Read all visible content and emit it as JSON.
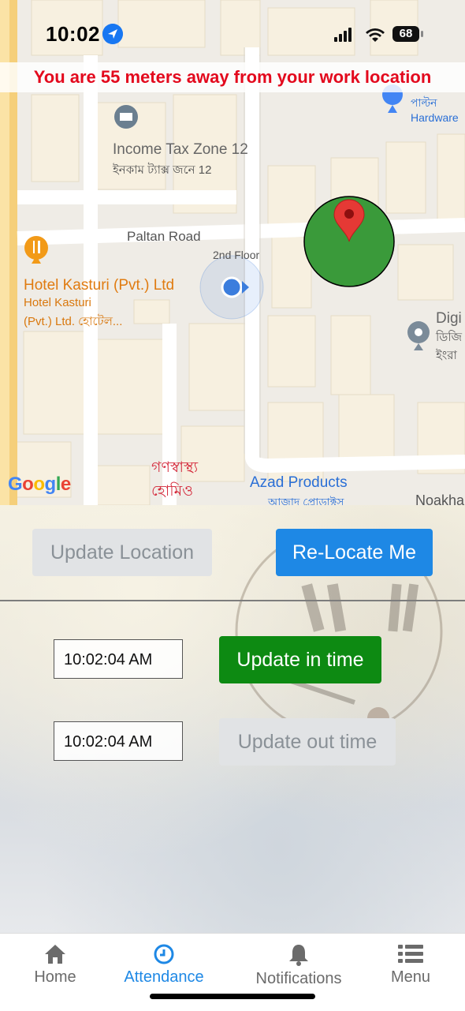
{
  "status_bar": {
    "time": "10:02",
    "battery": "68"
  },
  "banner": {
    "text": "You are 55 meters away from your work location"
  },
  "map": {
    "labels": {
      "income_tax_en": "Income Tax Zone 12",
      "income_tax_bn": "ইনকাম ট্যাক্স জনে 12",
      "paltan_road": "Paltan Road",
      "hotel_en": "Hotel Kasturi (Pvt.) Ltd",
      "hotel_sub1": "Hotel Kasturi",
      "hotel_sub2": "(Pvt.) Ltd. হোটেল...",
      "second_floor": "2nd Floor",
      "paltan_hw_bn": "পাল্টন",
      "paltan_hw_en": "Hardware",
      "digi_en": "Digi",
      "digi_bn1": "ডিজি",
      "digi_bn2": "ইংরা",
      "gono_bn1": "গণস্বাস্থ্য",
      "gono_bn2": "হোমিও",
      "azad_en": "Azad Products",
      "azad_bn": "আজাদ প্রোডাক্টস",
      "noakha": "Noakha",
      "google": [
        "G",
        "o",
        "o",
        "g",
        "l",
        "e"
      ]
    },
    "geofence_color": "#3a9a3a",
    "marker_color": "#e53935",
    "user_dot_color": "#3b7ddd"
  },
  "controls": {
    "update_location_label": "Update Location",
    "relocate_label": "Re-Locate Me",
    "in_time_value": "10:02:04 AM",
    "update_in_label": "Update in time",
    "out_time_value": "10:02:04 AM",
    "update_out_label": "Update out time"
  },
  "tabbar": {
    "home": "Home",
    "attendance": "Attendance",
    "notifications": "Notifications",
    "menu": "Menu",
    "active_color": "#1e88e5"
  }
}
